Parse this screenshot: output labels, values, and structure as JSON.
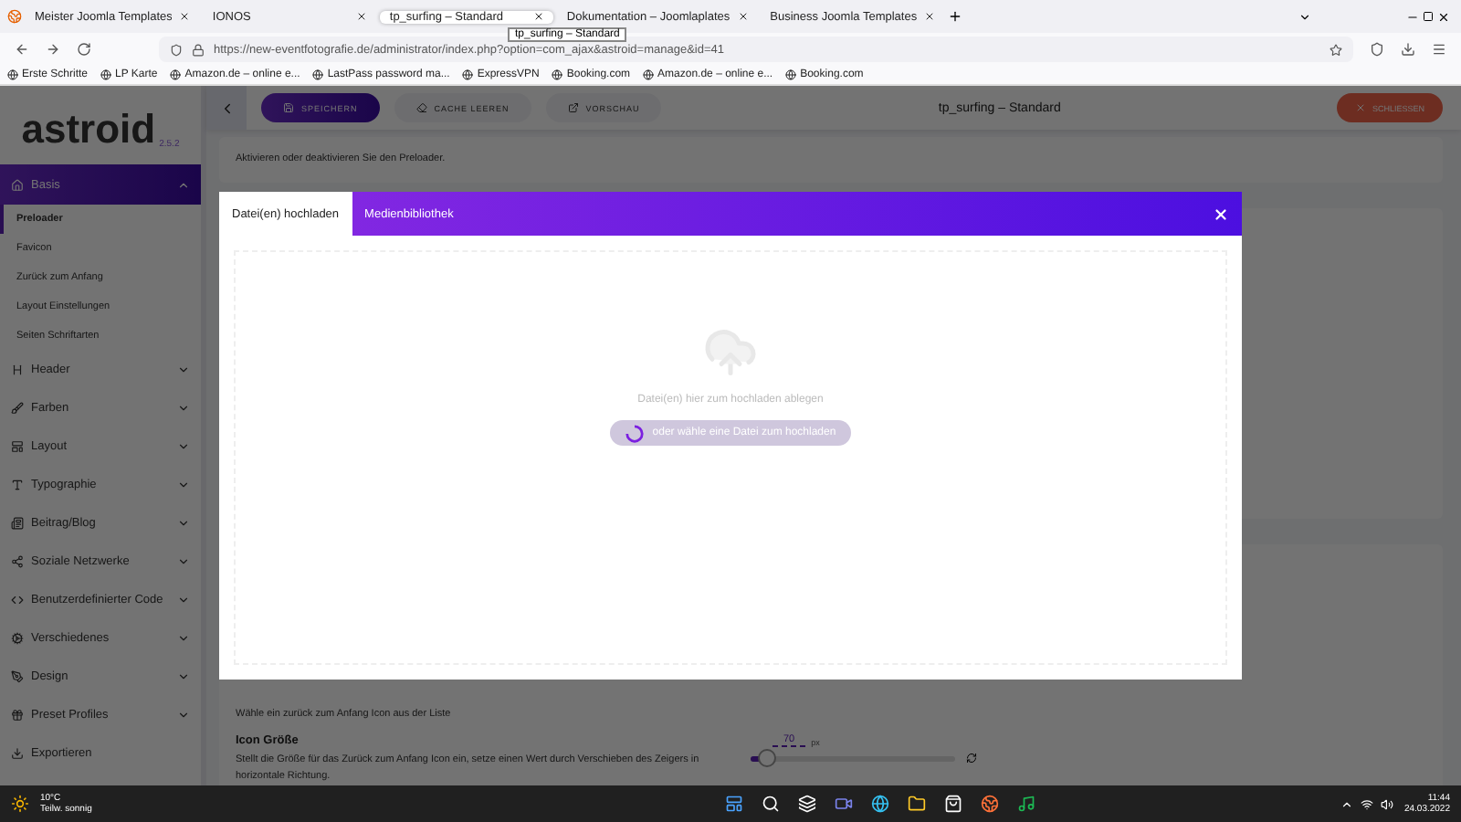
{
  "browser": {
    "tabs": [
      {
        "title": "Meister Joomla Templates",
        "selected": false
      },
      {
        "title": "IONOS",
        "selected": false
      },
      {
        "title": "tp_surfing – Standard",
        "selected": true
      },
      {
        "title": "Dokumentation – Joomlaplates",
        "selected": false
      },
      {
        "title": "Business Joomla Templates",
        "selected": false
      }
    ],
    "tooltip": "tp_surfing – Standard",
    "url": "https://new-eventfotografie.de/administrator/index.php?option=com_ajax&astroid=manage&id=41",
    "bookmarks": [
      "Erste Schritte",
      "LP Karte",
      "Amazon.de – online e...",
      "LastPass password ma...",
      "ExpressVPN",
      "Booking.com",
      "Amazon.de – online e...",
      "Booking.com"
    ]
  },
  "sidebar": {
    "logo": "astroid",
    "version": "2.5.2",
    "sections": [
      {
        "label": "Basis",
        "kind": "group",
        "expanded": true,
        "children": [
          {
            "label": "Preloader",
            "selected": true
          },
          {
            "label": "Favicon",
            "selected": false
          },
          {
            "label": "Zurück zum Anfang",
            "selected": false
          },
          {
            "label": "Layout Einstellungen",
            "selected": false
          },
          {
            "label": "Seiten Schriftarten",
            "selected": false
          }
        ]
      },
      {
        "label": "Header",
        "kind": "group",
        "expanded": false
      },
      {
        "label": "Farben",
        "kind": "group",
        "expanded": false
      },
      {
        "label": "Layout",
        "kind": "group",
        "expanded": false
      },
      {
        "label": "Typographie",
        "kind": "group",
        "expanded": false
      },
      {
        "label": "Beitrag/Blog",
        "kind": "group",
        "expanded": false
      },
      {
        "label": "Soziale Netzwerke",
        "kind": "group",
        "expanded": false
      },
      {
        "label": "Benutzerdefinierter Code",
        "kind": "group",
        "expanded": false
      },
      {
        "label": "Verschiedenes",
        "kind": "group",
        "expanded": false
      },
      {
        "label": "Design",
        "kind": "group",
        "expanded": false
      },
      {
        "label": "Preset Profiles",
        "kind": "group",
        "expanded": false
      },
      {
        "label": "Exportieren",
        "kind": "link",
        "expanded": false
      }
    ]
  },
  "toolbar": {
    "buttons": [
      {
        "label": "SPEICHERN",
        "kind": "primary"
      },
      {
        "label": "CACHE LEEREN",
        "kind": "plain"
      },
      {
        "label": "VORSCHAU",
        "kind": "plain"
      }
    ],
    "title": "tp_surfing – Standard",
    "close": "SCHLIESSEN"
  },
  "content": {
    "preloader_hint": "Aktivieren oder deaktivieren Sie den Preloader.",
    "icon_hint": "Wähle ein zurück zum Anfang Icon aus der Liste",
    "size_label": "Icon Größe",
    "size_hint": "Stellt die Größe für das Zurück zum Anfang Icon ein, setze einen Wert durch Verschieben des Zeigers in horizontale Richtung.",
    "size_value": "70",
    "size_unit": "px",
    "level": 0.08
  },
  "modal": {
    "tabs": [
      {
        "label": "Datei(en) hochladen",
        "selected": true
      },
      {
        "label": "Medienbibliothek",
        "selected": false
      }
    ],
    "drop_text": "Datei(en) hier zum hochladen ablegen",
    "browse_button": "oder wähle eine Datei zum hochladen",
    "loading": true
  },
  "taskbar": {
    "temperature": "10°C",
    "weather": "Teilw. sonnig",
    "time": "11:44",
    "date": "24.03.2022"
  }
}
